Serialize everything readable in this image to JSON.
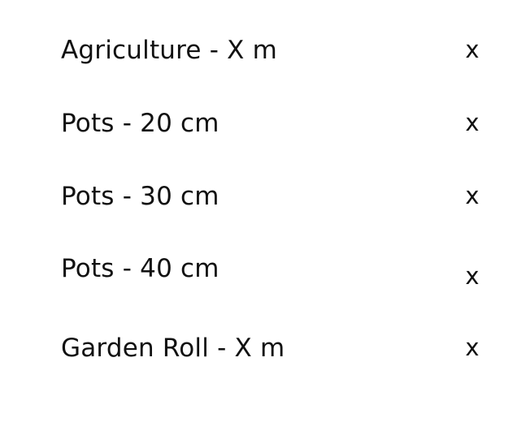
{
  "items": [
    {
      "label": "Agriculture - X m",
      "remove": "x"
    },
    {
      "label": "Pots - 20 cm",
      "remove": "x"
    },
    {
      "label": "Pots - 30 cm",
      "remove": "x"
    },
    {
      "label": "Pots - 40 cm",
      "remove": "x"
    },
    {
      "label": "Garden Roll - X m",
      "remove": "x"
    }
  ]
}
